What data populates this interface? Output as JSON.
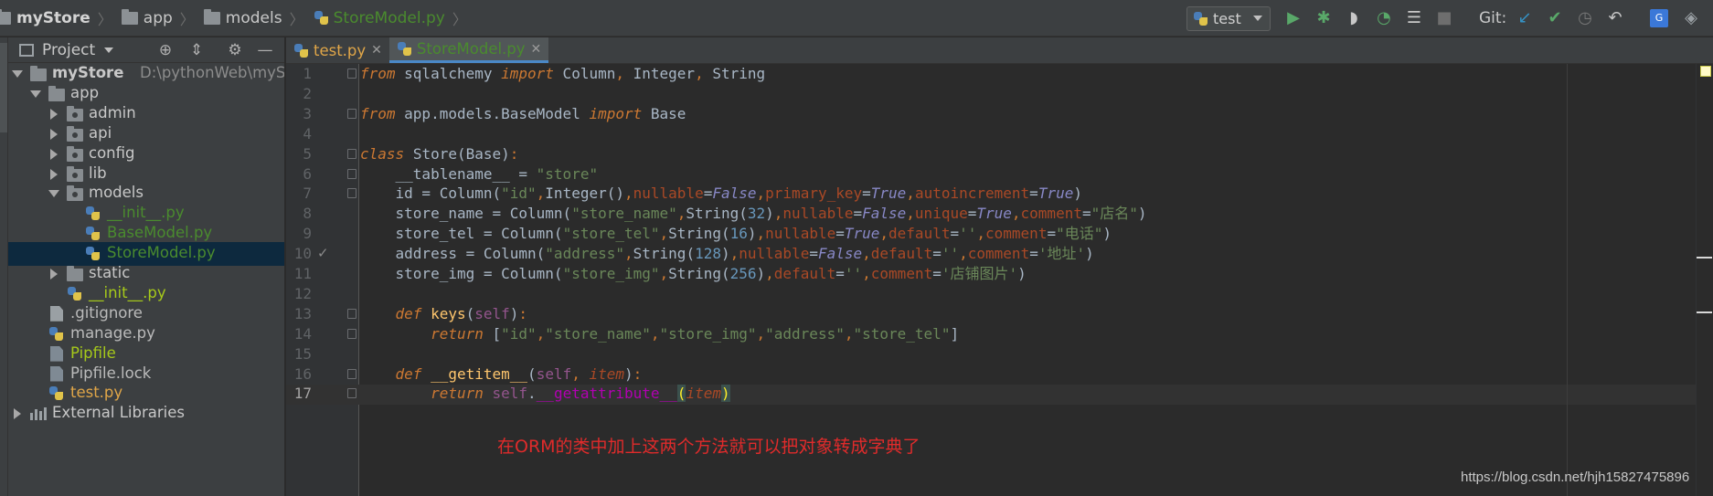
{
  "breadcrumb": {
    "project": "myStore",
    "items": [
      "app",
      "models"
    ],
    "file": "StoreModel.py"
  },
  "toolbar": {
    "run_config": "test",
    "git_label": "Git:",
    "icons": [
      "run-icon",
      "debug-icon",
      "coverage-icon",
      "profile-icon",
      "run-list-icon",
      "stop-icon",
      "vcs-update-icon",
      "vcs-commit-icon",
      "history-icon",
      "revert-icon",
      "translate-icon",
      "tool-icon"
    ]
  },
  "project_panel": {
    "title": "Project",
    "tree": [
      {
        "label": "myStore",
        "path": "D:\\pythonWeb\\myStore",
        "depth": 0,
        "expanded": true,
        "type": "folder-root"
      },
      {
        "label": "app",
        "depth": 1,
        "expanded": true,
        "type": "folder"
      },
      {
        "label": "admin",
        "depth": 2,
        "expanded": false,
        "type": "folder-pkg"
      },
      {
        "label": "api",
        "depth": 2,
        "expanded": false,
        "type": "folder-pkg"
      },
      {
        "label": "config",
        "depth": 2,
        "expanded": false,
        "type": "folder-pkg"
      },
      {
        "label": "lib",
        "depth": 2,
        "expanded": false,
        "type": "folder-pkg"
      },
      {
        "label": "models",
        "depth": 2,
        "expanded": true,
        "type": "folder-pkg"
      },
      {
        "label": "__init__.py",
        "depth": 3,
        "type": "py",
        "color": "#4a8b2e"
      },
      {
        "label": "BaseModel.py",
        "depth": 3,
        "type": "py",
        "color": "#4a8b2e"
      },
      {
        "label": "StoreModel.py",
        "depth": 3,
        "type": "py",
        "color": "#4a8b2e",
        "selected": true
      },
      {
        "label": "static",
        "depth": 2,
        "expanded": false,
        "type": "folder"
      },
      {
        "label": "__init__.py",
        "depth": 2,
        "type": "py",
        "color": "#a6c91a"
      },
      {
        "label": ".gitignore",
        "depth": 1,
        "type": "file",
        "color": "#bbbbbb"
      },
      {
        "label": "manage.py",
        "depth": 1,
        "type": "py",
        "color": "#bbbbbb"
      },
      {
        "label": "Pipfile",
        "depth": 1,
        "type": "file",
        "color": "#a6c91a"
      },
      {
        "label": "Pipfile.lock",
        "depth": 1,
        "type": "file",
        "color": "#bbbbbb"
      },
      {
        "label": "test.py",
        "depth": 1,
        "type": "py",
        "color": "#e0a648"
      },
      {
        "label": "External Libraries",
        "depth": 0,
        "expanded": false,
        "type": "lib"
      }
    ]
  },
  "tabs": [
    {
      "label": "test.py",
      "color": "#e0a648",
      "active": false
    },
    {
      "label": "StoreModel.py",
      "color": "#4a8b2e",
      "active": true
    }
  ],
  "editor": {
    "current_line": 17,
    "lines": [
      [
        [
          "kw",
          "from"
        ],
        [
          "t",
          " sqlalchemy "
        ],
        [
          "kw",
          "import"
        ],
        [
          "t",
          " Column"
        ],
        [
          "kw2",
          ","
        ],
        [
          "t",
          " Integer"
        ],
        [
          "kw2",
          ","
        ],
        [
          "t",
          " String"
        ]
      ],
      [],
      [
        [
          "kw",
          "from"
        ],
        [
          "t",
          " app.models.BaseModel "
        ],
        [
          "kw",
          "import"
        ],
        [
          "t",
          " Base"
        ]
      ],
      [],
      [
        [
          "kw",
          "class"
        ],
        [
          "t",
          " "
        ],
        [
          "cls",
          "Store"
        ],
        [
          "t",
          "(Base)"
        ],
        [
          "kw2",
          ":"
        ]
      ],
      [
        [
          "t",
          "    __tablename__ = "
        ],
        [
          "st",
          "\"store\""
        ]
      ],
      [
        [
          "t",
          "    id = Column("
        ],
        [
          "st",
          "\"id\""
        ],
        [
          "kw2",
          ","
        ],
        [
          "t",
          "Integer()"
        ],
        [
          "kw2",
          ","
        ],
        [
          "kv",
          "nullable"
        ],
        [
          "t",
          "="
        ],
        [
          "tru",
          "False"
        ],
        [
          "kw2",
          ","
        ],
        [
          "kv",
          "primary_key"
        ],
        [
          "t",
          "="
        ],
        [
          "tru",
          "True"
        ],
        [
          "kw2",
          ","
        ],
        [
          "kv",
          "autoincrement"
        ],
        [
          "t",
          "="
        ],
        [
          "tru",
          "True"
        ],
        [
          "t",
          ")"
        ]
      ],
      [
        [
          "t",
          "    store_name = Column("
        ],
        [
          "st",
          "\"store_name\""
        ],
        [
          "kw2",
          ","
        ],
        [
          "t",
          "String("
        ],
        [
          "nm",
          "32"
        ],
        [
          "t",
          ")"
        ],
        [
          "kw2",
          ","
        ],
        [
          "kv",
          "nullable"
        ],
        [
          "t",
          "="
        ],
        [
          "tru",
          "False"
        ],
        [
          "kw2",
          ","
        ],
        [
          "kv",
          "unique"
        ],
        [
          "t",
          "="
        ],
        [
          "tru",
          "True"
        ],
        [
          "kw2",
          ","
        ],
        [
          "kv",
          "comment"
        ],
        [
          "t",
          "="
        ],
        [
          "st",
          "\"店名\""
        ],
        [
          "t",
          ")"
        ]
      ],
      [
        [
          "t",
          "    store_tel = Column("
        ],
        [
          "st",
          "\"store_tel\""
        ],
        [
          "kw2",
          ","
        ],
        [
          "t",
          "String("
        ],
        [
          "nm",
          "16"
        ],
        [
          "t",
          ")"
        ],
        [
          "kw2",
          ","
        ],
        [
          "kv",
          "nullable"
        ],
        [
          "t",
          "="
        ],
        [
          "tru",
          "True"
        ],
        [
          "kw2",
          ","
        ],
        [
          "kv",
          "default"
        ],
        [
          "t",
          "="
        ],
        [
          "st",
          "''"
        ],
        [
          "kw2",
          ","
        ],
        [
          "kv",
          "comment"
        ],
        [
          "t",
          "="
        ],
        [
          "st",
          "\"电话\""
        ],
        [
          "t",
          ")"
        ]
      ],
      [
        [
          "t",
          "    address = Column("
        ],
        [
          "st",
          "\"address\""
        ],
        [
          "kw2",
          ","
        ],
        [
          "t",
          "String("
        ],
        [
          "nm",
          "128"
        ],
        [
          "t",
          ")"
        ],
        [
          "kw2",
          ","
        ],
        [
          "kv",
          "nullable"
        ],
        [
          "t",
          "="
        ],
        [
          "tru",
          "False"
        ],
        [
          "kw2",
          ","
        ],
        [
          "kv",
          "default"
        ],
        [
          "t",
          "="
        ],
        [
          "st",
          "''"
        ],
        [
          "kw2",
          ","
        ],
        [
          "kv",
          "comment"
        ],
        [
          "t",
          "="
        ],
        [
          "st",
          "'地址'"
        ],
        [
          "t",
          ")"
        ]
      ],
      [
        [
          "t",
          "    store_img = Column("
        ],
        [
          "st",
          "\"store_img\""
        ],
        [
          "kw2",
          ","
        ],
        [
          "t",
          "String("
        ],
        [
          "nm",
          "256"
        ],
        [
          "t",
          ")"
        ],
        [
          "kw2",
          ","
        ],
        [
          "kv",
          "default"
        ],
        [
          "t",
          "="
        ],
        [
          "st",
          "''"
        ],
        [
          "kw2",
          ","
        ],
        [
          "kv",
          "comment"
        ],
        [
          "t",
          "="
        ],
        [
          "st",
          "'店铺图片'"
        ],
        [
          "t",
          ")"
        ]
      ],
      [],
      [
        [
          "t",
          "    "
        ],
        [
          "kw",
          "def"
        ],
        [
          "t",
          " "
        ],
        [
          "fn",
          "keys"
        ],
        [
          "t",
          "("
        ],
        [
          "slf",
          "self"
        ],
        [
          "t",
          ")"
        ],
        [
          "kw2",
          ":"
        ]
      ],
      [
        [
          "t",
          "        "
        ],
        [
          "kw",
          "return"
        ],
        [
          "t",
          " ["
        ],
        [
          "st",
          "\"id\""
        ],
        [
          "kw2",
          ","
        ],
        [
          "st",
          "\"store_name\""
        ],
        [
          "kw2",
          ","
        ],
        [
          "st",
          "\"store_img\""
        ],
        [
          "kw2",
          ","
        ],
        [
          "st",
          "\"address\""
        ],
        [
          "kw2",
          ","
        ],
        [
          "st",
          "\"store_tel\""
        ],
        [
          "t",
          "]"
        ]
      ],
      [],
      [
        [
          "t",
          "    "
        ],
        [
          "kw",
          "def"
        ],
        [
          "t",
          " "
        ],
        [
          "fn",
          "__getitem__"
        ],
        [
          "t",
          "("
        ],
        [
          "slf",
          "self"
        ],
        [
          "kw2",
          ","
        ],
        [
          "t",
          " "
        ],
        [
          "pmi",
          "item"
        ],
        [
          "t",
          ")"
        ],
        [
          "kw2",
          ":"
        ]
      ],
      [
        [
          "t",
          "        "
        ],
        [
          "kw",
          "return"
        ],
        [
          "t",
          " "
        ],
        [
          "slf",
          "self"
        ],
        [
          "t",
          "."
        ],
        [
          "dunder",
          "__getattribute__"
        ],
        [
          "match",
          "("
        ],
        [
          "pmi",
          "item"
        ],
        [
          "match",
          ")"
        ]
      ]
    ]
  },
  "annotation": "在ORM的类中加上这两个方法就可以把对象转成字典了",
  "watermark": "https://blog.csdn.net/hjh15827475896"
}
